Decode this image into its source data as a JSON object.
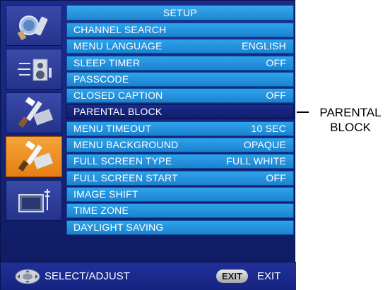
{
  "menu": {
    "title": "SETUP",
    "items": [
      {
        "label": "CHANNEL SEARCH",
        "value": ""
      },
      {
        "label": "MENU LANGUAGE",
        "value": "ENGLISH"
      },
      {
        "label": "SLEEP TIMER",
        "value": "OFF"
      },
      {
        "label": "PASSCODE",
        "value": ""
      },
      {
        "label": "CLOSED CAPTION",
        "value": "OFF"
      },
      {
        "label": "PARENTAL BLOCK",
        "value": "",
        "selected": true
      },
      {
        "label": "MENU TIMEOUT",
        "value": "10 SEC"
      },
      {
        "label": "MENU BACKGROUND",
        "value": "OPAQUE"
      },
      {
        "label": "FULL SCREEN TYPE",
        "value": "FULL WHITE"
      },
      {
        "label": "FULL SCREEN START",
        "value": "OFF"
      },
      {
        "label": "IMAGE SHIFT",
        "value": ""
      },
      {
        "label": "TIME ZONE",
        "value": ""
      },
      {
        "label": "DAYLIGHT SAVING",
        "value": ""
      }
    ]
  },
  "sidebar": {
    "icons": [
      {
        "icon": "picture-icon",
        "active": false
      },
      {
        "icon": "audio-icon",
        "active": false
      },
      {
        "icon": "tools-icon",
        "active": false
      },
      {
        "icon": "setup-tools-icon",
        "active": true
      },
      {
        "icon": "tv-antenna-icon",
        "active": false
      }
    ]
  },
  "footer": {
    "nav_label": "SELECT/ADJUST",
    "exit_badge": "EXIT",
    "exit_label": "EXIT"
  },
  "callout": {
    "line1": "PARENTAL",
    "line2": "BLOCK"
  },
  "colors": {
    "panel": "#142377",
    "item": "#1f86d0",
    "selected_item": "#101d6a",
    "active_icon": "#f08c20"
  }
}
